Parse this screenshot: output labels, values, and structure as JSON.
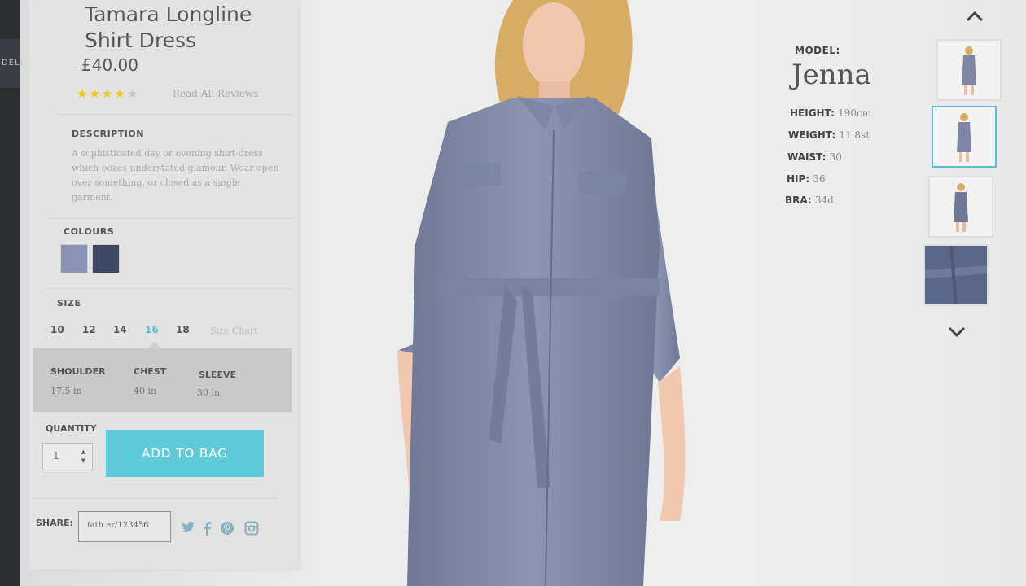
{
  "product": {
    "title": "Tamara Longline Shirt Dress",
    "price": "£40.00",
    "rating": 4,
    "rating_max": 5,
    "reviews_link": "Read All Reviews",
    "description_heading": "DESCRIPTION",
    "description": "A sophisticated day or evening shirt-dress which oozes understated glamour. Wear open over something, or closed as a single garment.",
    "colours_heading": "COLOURS",
    "colours": [
      "#8a93b6",
      "#3e4766"
    ],
    "size_heading": "SIZE",
    "sizes": [
      "10",
      "12",
      "14",
      "16",
      "18"
    ],
    "selected_size": "16",
    "size_chart": "Size Chart",
    "measurements": [
      {
        "label": "SHOULDER",
        "value": "17.5 in"
      },
      {
        "label": "CHEST",
        "value": "40 in"
      },
      {
        "label": "SLEEVE",
        "value": "30 in"
      }
    ],
    "quantity_heading": "QUANTITY",
    "quantity": "1",
    "add_to_bag": "ADD TO BAG",
    "share_heading": "SHARE:",
    "share_url": "fath.er/123456"
  },
  "model": {
    "label": "MODEL:",
    "name": "Jenna",
    "stats": [
      {
        "label": "HEIGHT:",
        "value": "190cm"
      },
      {
        "label": "WEIGHT:",
        "value": "11.8st"
      },
      {
        "label": "WAIST:",
        "value": "30"
      },
      {
        "label": "HIP:",
        "value": "36"
      },
      {
        "label": "BRA:",
        "value": "34d"
      }
    ]
  },
  "edge_text": "DELI",
  "colors": {
    "accent": "#5fcbd9",
    "stars": "#f2c514"
  }
}
